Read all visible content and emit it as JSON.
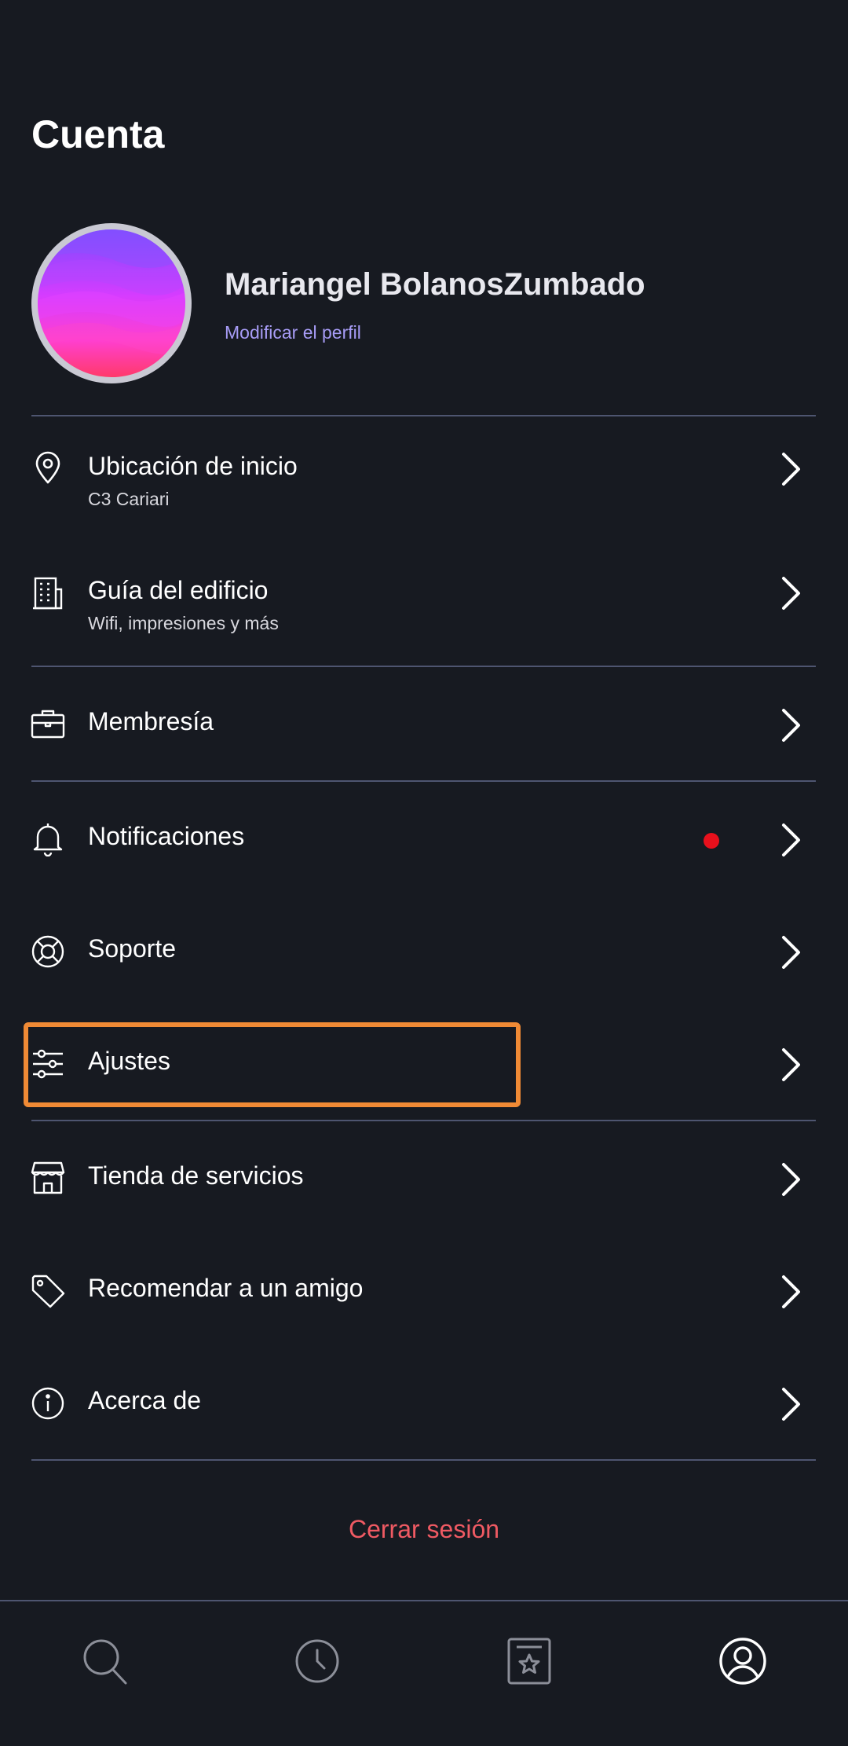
{
  "header": {
    "title": "Cuenta"
  },
  "profile": {
    "name": "Mariangel BolanosZumbado",
    "edit_label": "Modificar el perfil"
  },
  "menu": {
    "home_location": {
      "label": "Ubicación de inicio",
      "sub": "C3 Cariari",
      "icon": "location-pin-icon"
    },
    "building_guide": {
      "label": "Guía del edificio",
      "sub": "Wifi, impresiones y más",
      "icon": "building-icon"
    },
    "membership": {
      "label": "Membresía",
      "icon": "briefcase-icon"
    },
    "notifications": {
      "label": "Notificaciones",
      "icon": "bell-icon",
      "has_unread_dot": true
    },
    "support": {
      "label": "Soporte",
      "icon": "lifebuoy-icon"
    },
    "settings": {
      "label": "Ajustes",
      "icon": "sliders-icon"
    },
    "service_store": {
      "label": "Tienda de servicios",
      "icon": "store-icon"
    },
    "refer_friend": {
      "label": "Recomendar a un amigo",
      "icon": "tag-icon"
    },
    "about": {
      "label": "Acerca de",
      "icon": "info-icon"
    }
  },
  "logout": {
    "label": "Cerrar sesión"
  },
  "bottom_nav": {
    "items": [
      {
        "icon": "search-icon"
      },
      {
        "icon": "clock-icon"
      },
      {
        "icon": "bookmark-star-icon"
      },
      {
        "icon": "account-icon",
        "active": true
      }
    ]
  },
  "colors": {
    "background": "#171a21",
    "divider": "#4e5570",
    "link": "#a79cf6",
    "logout": "#f05a63",
    "highlight": "#f08a35",
    "notification_dot": "#e8101c"
  }
}
